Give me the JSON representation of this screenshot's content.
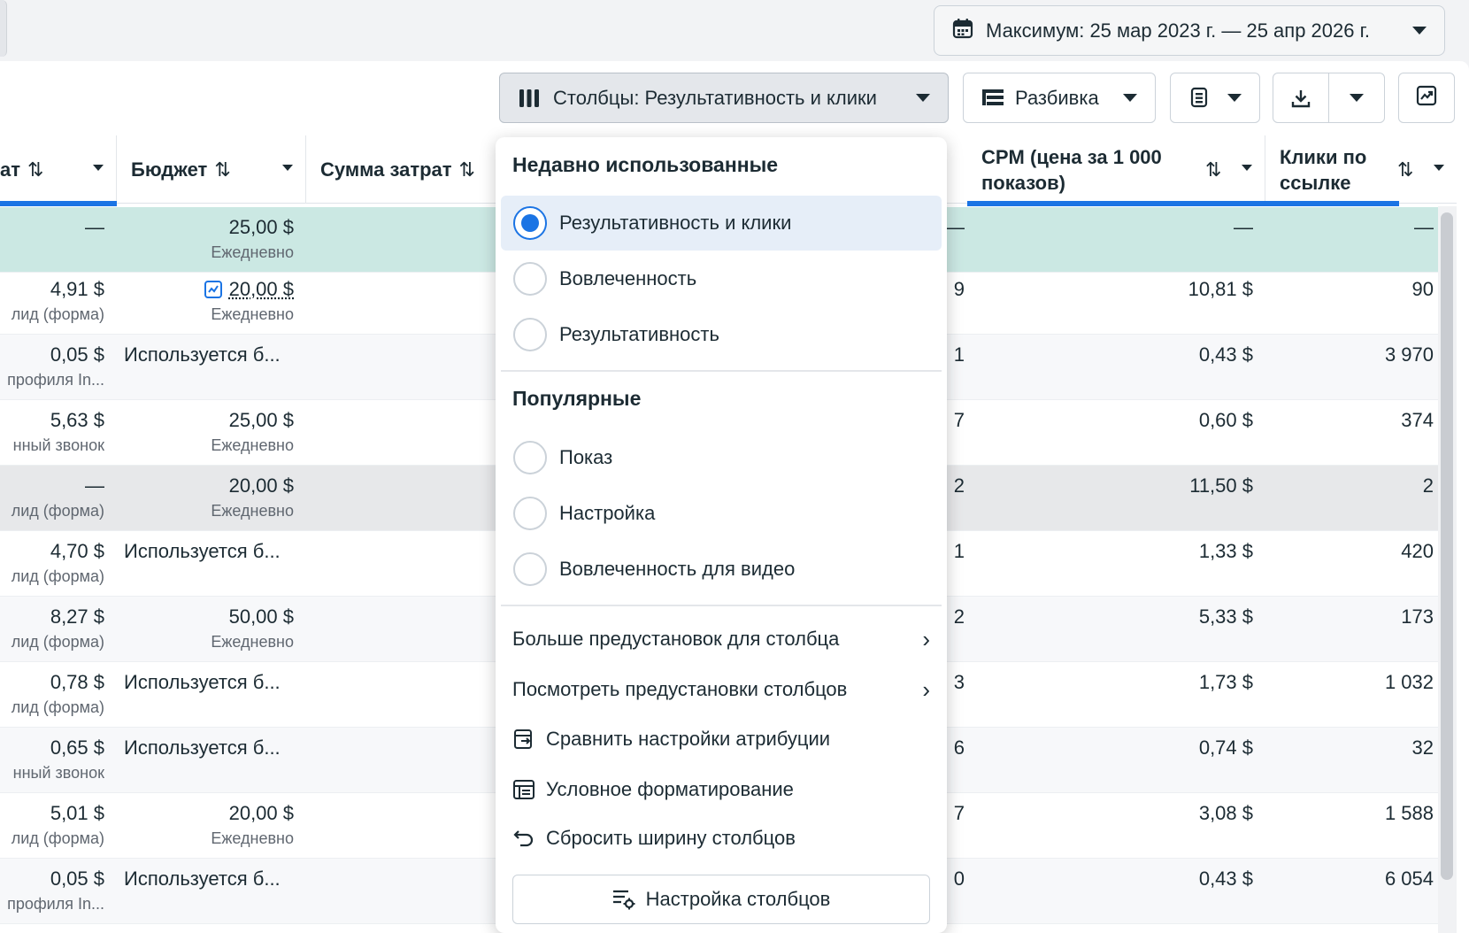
{
  "date_range": {
    "label": "Максимум: 25 мар 2023 г. — 25 апр 2026 г."
  },
  "toolbar": {
    "columns_label": "Столбцы: Результативность и клики",
    "breakdown_label": "Разбивка"
  },
  "table": {
    "headers": {
      "col1": "ат",
      "budget": "Бюджет",
      "spend": "Сумма затрат",
      "cpm": "CPM (цена за 1 000 показов)",
      "clicks": "Клики по ссылке"
    },
    "rows": [
      {
        "c1": "—",
        "c1_sub": "",
        "budget": "25,00 $",
        "budget_sub": "Ежедневно",
        "edge": "—",
        "cpm": "—",
        "clicks": "—"
      },
      {
        "c1": "4,91 $",
        "c1_sub": "лид (форма)",
        "budget": "20,00 $",
        "budget_sub": "Ежедневно",
        "edge": "9",
        "cpm": "10,81 $",
        "clicks": "90"
      },
      {
        "c1": "0,05 $",
        "c1_sub": "профиля In...",
        "budget": "Используется б...",
        "budget_sub": "",
        "edge": "1",
        "cpm": "0,43 $",
        "clicks": "3 970"
      },
      {
        "c1": "5,63 $",
        "c1_sub": "нный звонок",
        "budget": "25,00 $",
        "budget_sub": "Ежедневно",
        "edge": "7",
        "cpm": "0,60 $",
        "clicks": "374"
      },
      {
        "c1": "—",
        "c1_sub": "лид (форма)",
        "budget": "20,00 $",
        "budget_sub": "Ежедневно",
        "edge": "2",
        "cpm": "11,50 $",
        "clicks": "2"
      },
      {
        "c1": "4,70 $",
        "c1_sub": "лид (форма)",
        "budget": "Используется б...",
        "budget_sub": "",
        "edge": "1",
        "cpm": "1,33 $",
        "clicks": "420"
      },
      {
        "c1": "8,27 $",
        "c1_sub": "лид (форма)",
        "budget": "50,00 $",
        "budget_sub": "Ежедневно",
        "edge": "2",
        "cpm": "5,33 $",
        "clicks": "173"
      },
      {
        "c1": "0,78 $",
        "c1_sub": "лид (форма)",
        "budget": "Используется б...",
        "budget_sub": "",
        "edge": "3",
        "cpm": "1,73 $",
        "clicks": "1 032"
      },
      {
        "c1": "0,65 $",
        "c1_sub": "нный звонок",
        "budget": "Используется б...",
        "budget_sub": "",
        "edge": "6",
        "cpm": "0,74 $",
        "clicks": "32"
      },
      {
        "c1": "5,01 $",
        "c1_sub": "лид (форма)",
        "budget": "20,00 $",
        "budget_sub": "Ежедневно",
        "edge": "7",
        "cpm": "3,08 $",
        "clicks": "1 588"
      },
      {
        "c1": "0,05 $",
        "c1_sub": "профиля In...",
        "budget": "Используется б...",
        "budget_sub": "",
        "edge": "0",
        "cpm": "0,43 $",
        "clicks": "6 054"
      }
    ]
  },
  "dropdown": {
    "recent_heading": "Недавно использованные",
    "recent": [
      {
        "label": "Результативность и клики",
        "selected": true
      },
      {
        "label": "Вовлеченность",
        "selected": false
      },
      {
        "label": "Результативность",
        "selected": false
      }
    ],
    "popular_heading": "Популярные",
    "popular": [
      {
        "label": "Показ",
        "selected": false
      },
      {
        "label": "Настройка",
        "selected": false
      },
      {
        "label": "Вовлеченность для видео",
        "selected": false
      }
    ],
    "more_presets": "Больше предустановок для столбца",
    "view_presets": "Посмотреть предустановки столбцов",
    "compare_attribution": "Сравнить настройки атрибуции",
    "conditional_formatting": "Условное форматирование",
    "reset_widths": "Сбросить ширину столбцов",
    "customize_columns": "Настройка столбцов"
  }
}
